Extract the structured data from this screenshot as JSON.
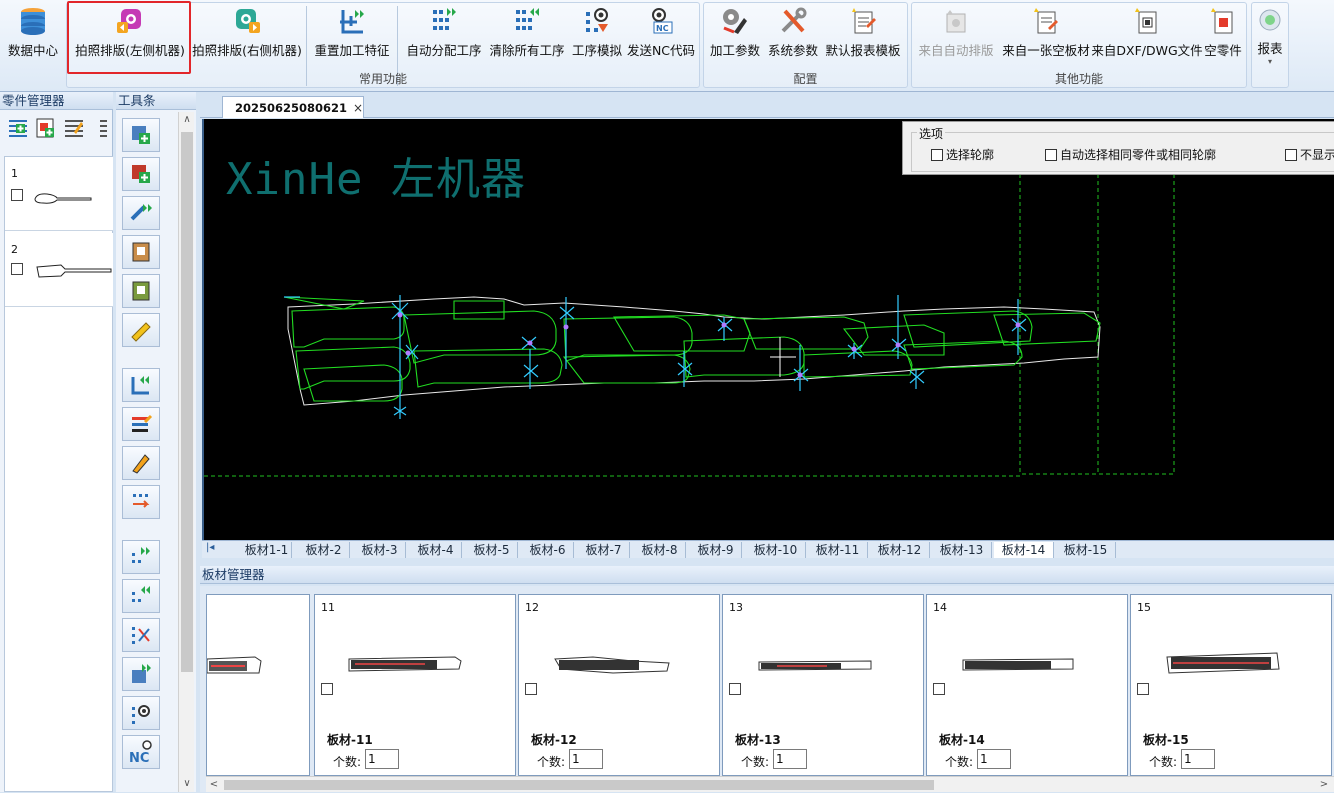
{
  "ribbon": {
    "buttons": [
      {
        "label": "数据中心",
        "icon": "database-icon"
      },
      {
        "label": "拍照排版(左侧机器)",
        "icon": "camera-left-icon"
      },
      {
        "label": "拍照排版(右侧机器)",
        "icon": "camera-right-icon"
      },
      {
        "label": "重置加工特征",
        "icon": "reset-feature-icon"
      },
      {
        "label": "自动分配工序",
        "icon": "auto-assign-icon"
      },
      {
        "label": "清除所有工序",
        "icon": "clear-process-icon"
      },
      {
        "label": "工序模拟",
        "icon": "simulate-icon"
      },
      {
        "label": "发送NC代码",
        "icon": "send-nc-icon"
      },
      {
        "label": "加工参数",
        "icon": "process-params-icon"
      },
      {
        "label": "系统参数",
        "icon": "system-params-icon"
      },
      {
        "label": "默认报表模板",
        "icon": "report-template-icon"
      },
      {
        "label": "来自自动排版",
        "icon": "auto-nest-icon",
        "disabled": true
      },
      {
        "label": "来自一张空板材",
        "icon": "empty-sheet-icon"
      },
      {
        "label": "来自DXF/DWG文件",
        "icon": "dxf-file-icon"
      },
      {
        "label": "空零件",
        "icon": "empty-part-icon"
      },
      {
        "label": "报表",
        "icon": "report-icon"
      }
    ],
    "groups": {
      "common": "常用功能",
      "config": "配置",
      "other": "其他功能"
    }
  },
  "parts_panel": {
    "title": "零件管理器",
    "items": [
      {
        "num": "1"
      },
      {
        "num": "2"
      }
    ]
  },
  "tools_panel": {
    "title": "工具条"
  },
  "document": {
    "tab": "20250625080621",
    "close": "×"
  },
  "canvas": {
    "watermark": "XinHe 左机器",
    "options": {
      "legend": "选项",
      "items": [
        "选择轮廓",
        "自动选择相同零件或相同轮廓",
        "不显示"
      ]
    }
  },
  "sheet_tabs": [
    "板材1-1",
    "板材-2",
    "板材-3",
    "板材-4",
    "板材-5",
    "板材-6",
    "板材-7",
    "板材-8",
    "板材-9",
    "板材-10",
    "板材-11",
    "板材-12",
    "板材-13",
    "板材-14",
    "板材-15"
  ],
  "active_sheet_tab": "板材-14",
  "sheet_manager": {
    "title": "板材管理器",
    "qty_label": "个数:",
    "cards": [
      {
        "num": "11",
        "name": "板材-11",
        "qty": "1"
      },
      {
        "num": "12",
        "name": "板材-12",
        "qty": "1"
      },
      {
        "num": "13",
        "name": "板材-13",
        "qty": "1"
      },
      {
        "num": "14",
        "name": "板材-14",
        "qty": "1"
      },
      {
        "num": "15",
        "name": "板材-15",
        "qty": "1"
      }
    ]
  },
  "colors": {
    "canvas_bg": "#000000",
    "outline": "#ffffff",
    "toolpath": "#22dd22",
    "marker": "#33ccff",
    "watermark": "#0f6f6f",
    "highlight": "#e2262a"
  }
}
